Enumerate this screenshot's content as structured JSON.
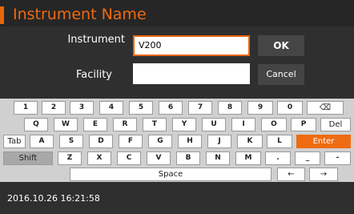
{
  "dialog": {
    "title": "Instrument Name",
    "instrument_label": "Instrument",
    "instrument_value": "V200",
    "facility_label": "Facility",
    "facility_value": "",
    "ok_label": "OK",
    "cancel_label": "Cancel"
  },
  "keyboard": {
    "row1": [
      "1",
      "2",
      "3",
      "4",
      "5",
      "6",
      "7",
      "8",
      "9",
      "0",
      "⌫"
    ],
    "row2": [
      "Q",
      "W",
      "E",
      "R",
      "T",
      "Y",
      "U",
      "I",
      "O",
      "P",
      "Del"
    ],
    "row3": [
      "Tab",
      "A",
      "S",
      "D",
      "F",
      "G",
      "H",
      "J",
      "K",
      "L",
      "Enter"
    ],
    "row4": [
      "Shift",
      "Z",
      "X",
      "C",
      "V",
      "B",
      "N",
      "M",
      ".",
      "_",
      "-"
    ],
    "row5": [
      "Space",
      "←",
      "→"
    ]
  },
  "status": {
    "datetime": "2016.10.26  16:21:58"
  },
  "colors": {
    "accent": "#ef6b12",
    "background": "#2f2f2f",
    "keyboard_bg": "#d0d0d0"
  }
}
